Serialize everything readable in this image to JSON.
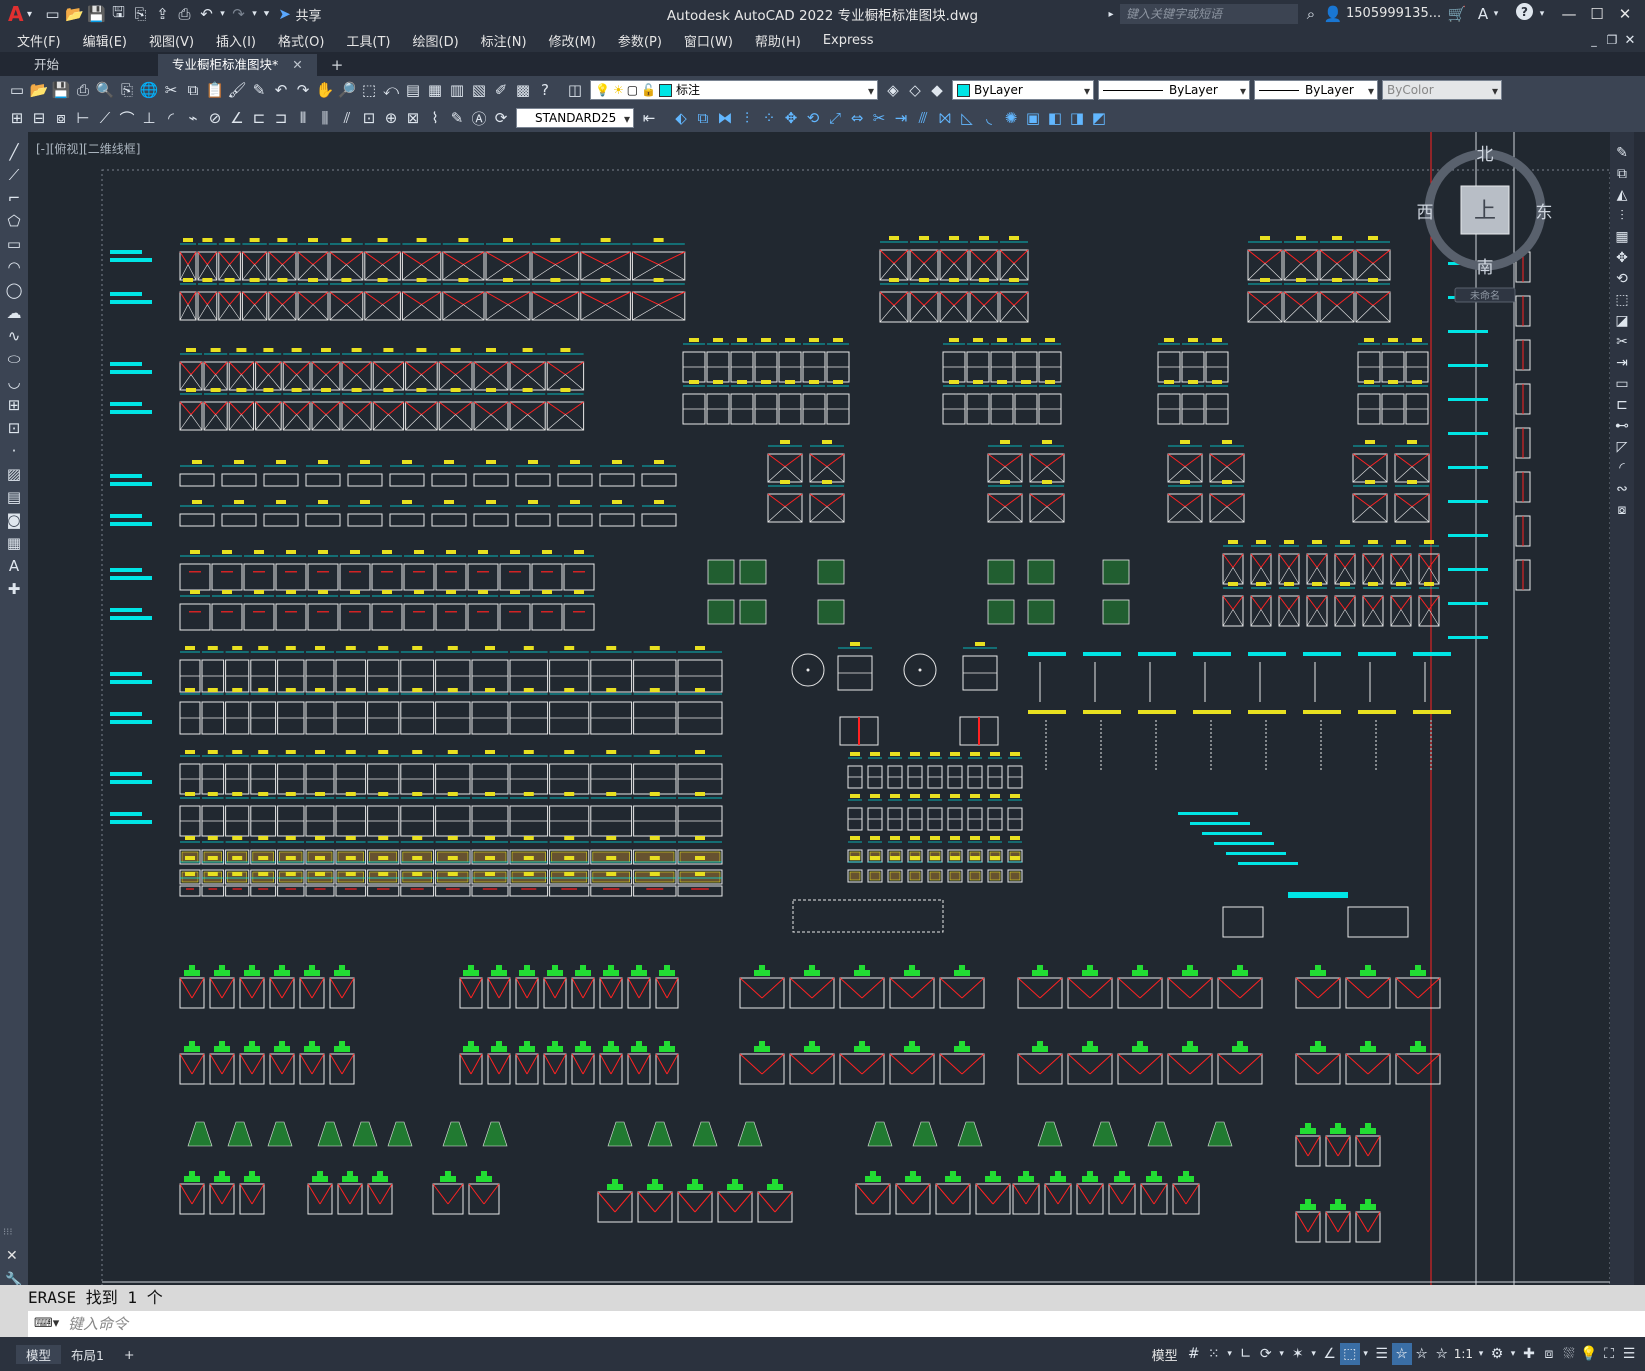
{
  "titlebar": {
    "app_letter": "A",
    "share_label": "共享",
    "title": "Autodesk AutoCAD 2022    专业橱柜标准图块.dwg",
    "search_placeholder": "键入关键字或短语",
    "user": "1505999135...",
    "help": "?"
  },
  "menu": [
    "文件(F)",
    "编辑(E)",
    "视图(V)",
    "插入(I)",
    "格式(O)",
    "工具(T)",
    "绘图(D)",
    "标注(N)",
    "修改(M)",
    "参数(P)",
    "窗口(W)",
    "帮助(H)",
    "Express"
  ],
  "tabs": {
    "start": "开始",
    "drawing": "专业橱柜标准图块*",
    "add": "+"
  },
  "toolbar": {
    "layer": "标注",
    "color": "ByLayer",
    "linetype": "ByLayer",
    "lineweight": "ByLayer",
    "plotstyle": "ByColor",
    "dimstyle": "STANDARD25"
  },
  "viewport": {
    "label": "[-][俯视][二维线框]"
  },
  "viewcube": {
    "north": "北",
    "south": "南",
    "east": "东",
    "west": "西",
    "top": "上",
    "ucs": "未命名"
  },
  "command": {
    "history": "ERASE  找到 1 个",
    "placeholder": "键入命令"
  },
  "status": {
    "model_tab": "模型",
    "layout_tab": "布局1",
    "add_tab": "+",
    "model_space": "模型",
    "scale": "1:1"
  },
  "colors": {
    "cyan": "#00e5e5",
    "red": "#ff2222",
    "green": "#22dd33",
    "yellow": "#e8e020",
    "white": "#e8e8e8",
    "background": "#212830"
  }
}
